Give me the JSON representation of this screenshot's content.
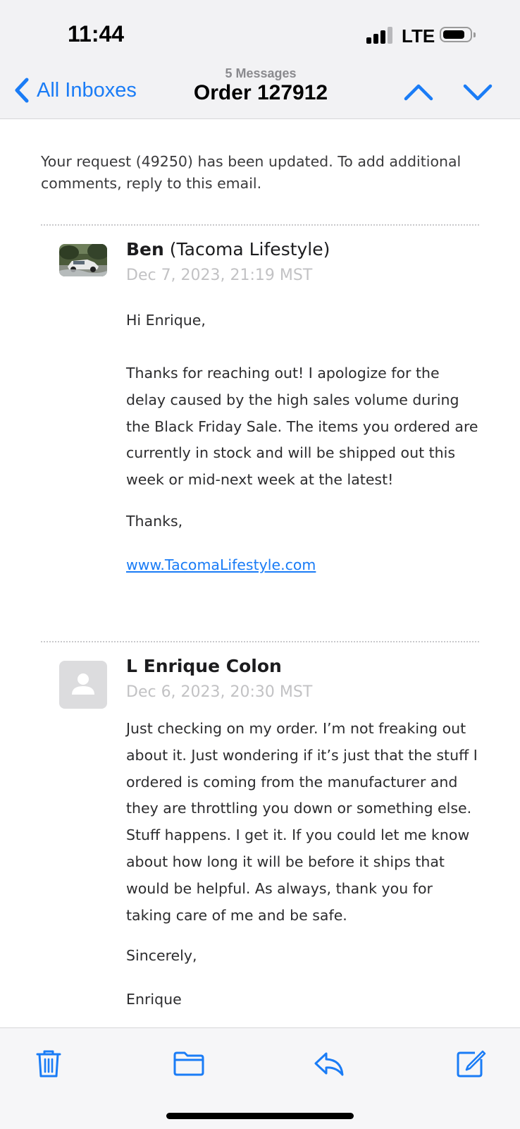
{
  "status_bar": {
    "time": "11:44",
    "network": "LTE"
  },
  "nav": {
    "back_label": "All Inboxes",
    "message_count": "5 Messages",
    "title": "Order 127912",
    "accent_color": "#1a7cf6"
  },
  "thread": {
    "intro": "Your request (49250) has been updated. To add additional comments, reply to this email.",
    "messages": [
      {
        "sender_name": "Ben",
        "sender_org": "(Tacoma Lifestyle)",
        "date": "Dec 7, 2023, 21:19 MST",
        "paragraphs": [
          "Hi Enrique,",
          "Thanks for reaching out! I apologize for the delay caused by the high sales volume during the Black Friday Sale. The items you ordered are currently in stock and will be shipped out this week or mid-next week at the latest!",
          "Thanks,"
        ],
        "link": "www.TacomaLifestyle.com"
      },
      {
        "sender_name": "L Enrique Colon",
        "date": "Dec 6, 2023, 20:30 MST",
        "paragraphs": [
          "Just checking on my order. I’m not freaking out about it. Just wondering if it’s just that the stuff I ordered is coming from the manufacturer and they are throttling you down or something else. Stuff happens. I get it. If you could let me know about how long it will be before it ships that would be helpful. As always, thank you for taking care of me and be safe.",
          "Sincerely,",
          "Enrique"
        ]
      }
    ]
  },
  "toolbar": {
    "icons": [
      "trash-icon",
      "folder-icon",
      "reply-icon",
      "compose-icon"
    ]
  }
}
